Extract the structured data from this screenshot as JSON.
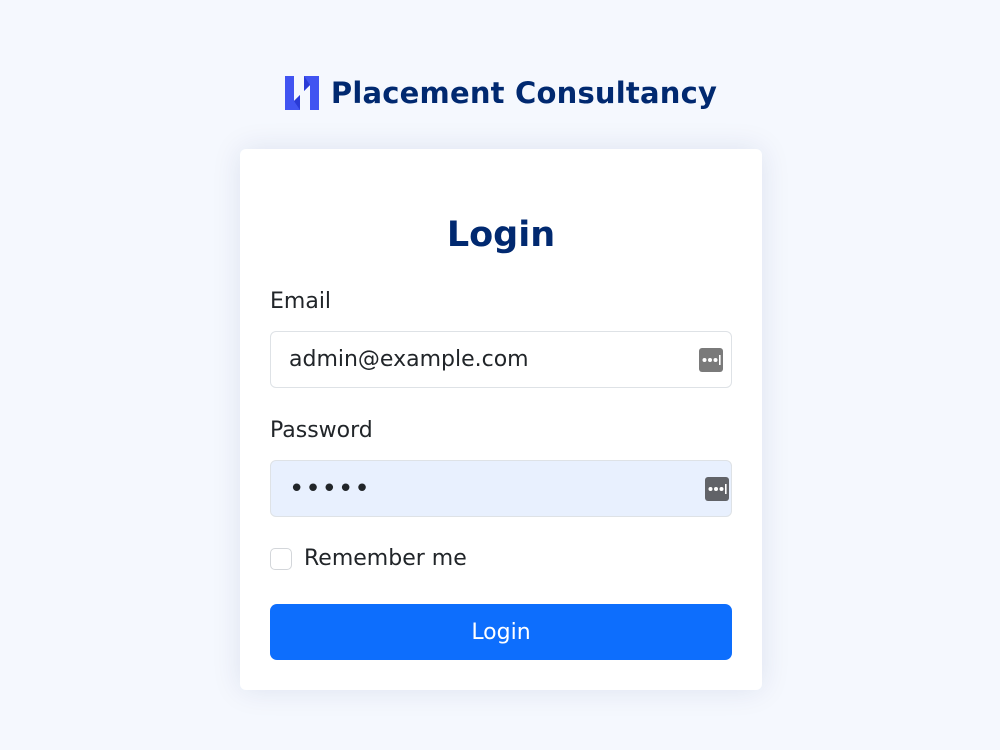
{
  "brand": {
    "name": "Placement Consultancy",
    "logo_icon": "brand-logo-icon",
    "color": "#012970",
    "logo_color": "#4154f1"
  },
  "login_card": {
    "title": "Login",
    "email": {
      "label": "Email",
      "value": "admin@example.com",
      "icon": "password-manager-icon"
    },
    "password": {
      "label": "Password",
      "value": "•••••",
      "icon": "password-manager-icon"
    },
    "remember": {
      "label": "Remember me",
      "checked": false
    },
    "submit_label": "Login",
    "accent_color": "#0d6efd"
  }
}
